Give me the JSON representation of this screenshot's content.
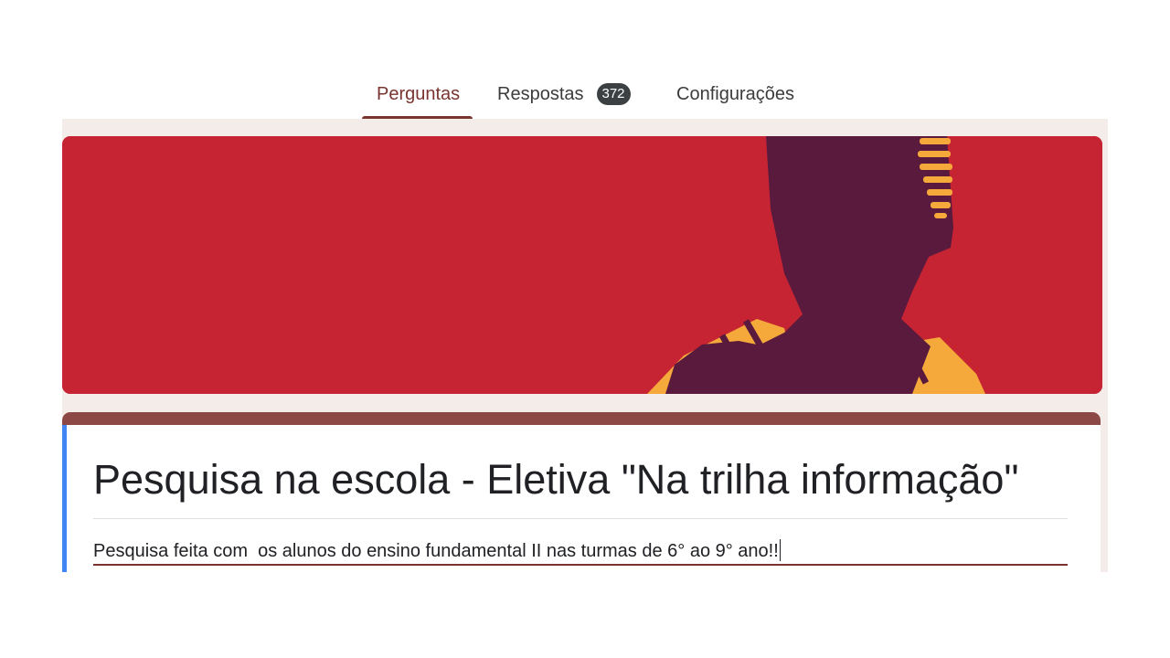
{
  "tabs": {
    "questions": "Perguntas",
    "responses": "Respostas",
    "responses_count": "372",
    "settings": "Configurações"
  },
  "form": {
    "title": "Pesquisa na escola - Eletiva \"Na trilha informação\"",
    "description": "Pesquisa feita com  os alunos do ensino fundamental II nas turmas de 6° ao 9° ano!!"
  },
  "colors": {
    "accent": "#7a3430",
    "banner_bg": "#c62433",
    "card_top": "#8c4844",
    "focus_bar": "#4285f4",
    "canvas_bg": "#f3ece9"
  },
  "banner": {
    "image": "header-illustration-silhouette"
  }
}
